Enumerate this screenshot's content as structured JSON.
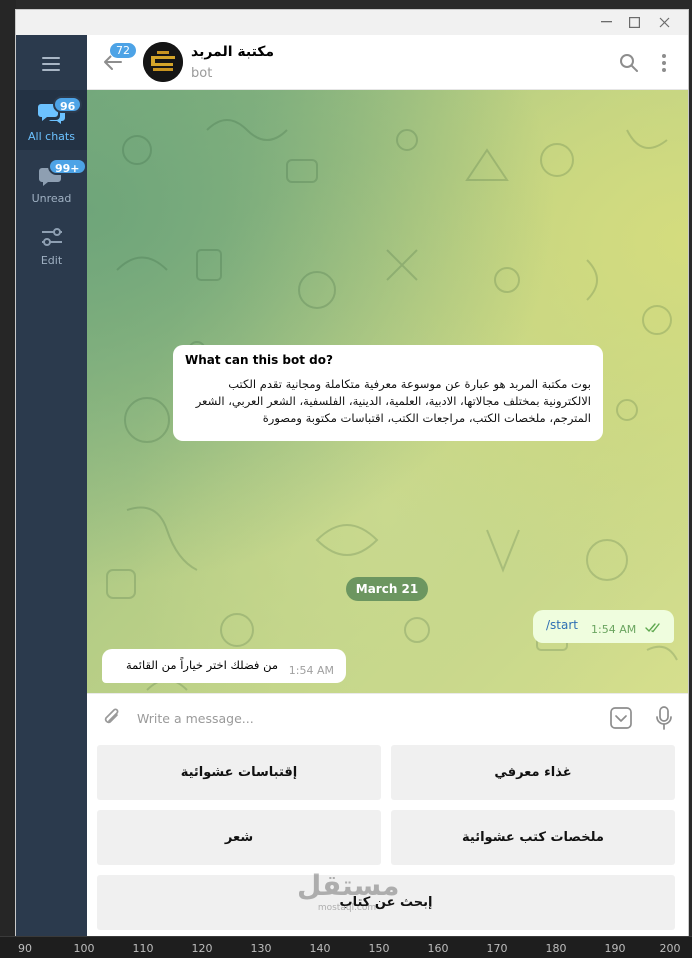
{
  "window": {
    "minimize_icon": "minimize-icon",
    "maximize_icon": "maximize-icon",
    "close_icon": "close-icon"
  },
  "nav": {
    "items": [
      {
        "label": "All chats",
        "badge": "96",
        "icon": "chat-bubbles-icon"
      },
      {
        "label": "Unread",
        "badge": "99+",
        "icon": "chat-bubble-icon"
      },
      {
        "label": "Edit",
        "badge": "",
        "icon": "sliders-icon"
      }
    ]
  },
  "header": {
    "back_badge": "72",
    "title": "مكتبة المربد",
    "subtitle": "bot"
  },
  "info_card": {
    "title": "What can this bot do?",
    "text": "بوت مكتبة المربد هو عبارة عن موسوعة معرفية متكاملة ومجانية تقدم الكتب الالكترونية بمختلف مجالاتها، الادبية، العلمية، الدينية، الفلسفية، الشعر العربي، الشعر المترجم، ملخصات الكتب، مراجعات الكتب، اقتباسات مكتوبة ومصورة"
  },
  "date_label": "March 21",
  "messages": [
    {
      "direction": "out",
      "text": "/start",
      "time": "1:54 AM",
      "status": "read"
    },
    {
      "direction": "in",
      "text": "من فضلك اختر خياراً من القائمة",
      "time": "1:54 AM"
    }
  ],
  "composer": {
    "placeholder": "Write a message..."
  },
  "keyboard": {
    "buttons": [
      "غذاء معرفي",
      "إقتباسات عشوائية",
      "ملخصات كتب عشوائية",
      "شعر",
      "إبحث عن كتاب"
    ]
  },
  "watermark": {
    "arabic": "مستقل",
    "latin": "mostaql.com"
  },
  "ruler": {
    "ticks": [
      "90",
      "100",
      "110",
      "120",
      "130",
      "140",
      "150",
      "160",
      "170",
      "180",
      "190",
      "200"
    ]
  },
  "colors": {
    "accent": "#4da3e6",
    "sidebar": "#2b3a4d",
    "outgoing_bubble": "#effdde",
    "date_pill": "#4e8052"
  }
}
